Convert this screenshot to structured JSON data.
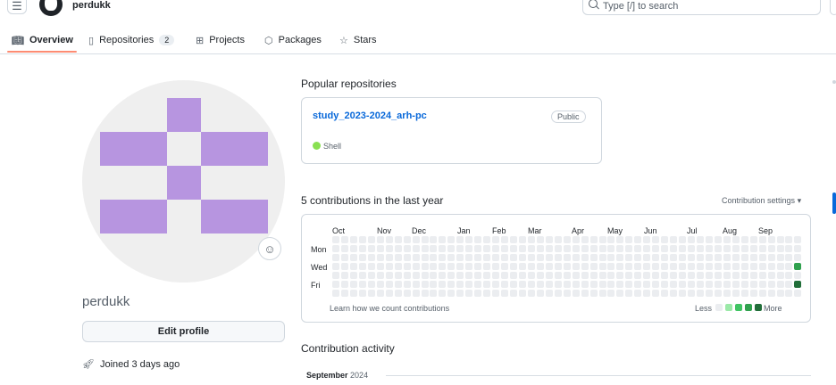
{
  "header": {
    "username": "perdukk",
    "search_placeholder": "Type [/] to search"
  },
  "tabs": [
    {
      "label": "Overview",
      "icon": "book-icon"
    },
    {
      "label": "Repositories",
      "icon": "repo-icon",
      "count": "2"
    },
    {
      "label": "Projects",
      "icon": "table-icon"
    },
    {
      "label": "Packages",
      "icon": "package-icon"
    },
    {
      "label": "Stars",
      "icon": "star-icon"
    }
  ],
  "profile": {
    "name": "perdukk",
    "edit_label": "Edit profile",
    "joined": "Joined 3 days ago",
    "avatar_color": "#b795e0"
  },
  "popular": {
    "title": "Popular repositories",
    "repos": [
      {
        "name": "study_2023-2024_arh-pc",
        "visibility": "Public",
        "language": "Shell",
        "language_color": "#89e051"
      }
    ]
  },
  "contributions": {
    "title": "5 contributions in the last year",
    "settings_label": "Contribution settings",
    "months": [
      "Oct",
      "Nov",
      "Dec",
      "Jan",
      "Feb",
      "Mar",
      "Apr",
      "May",
      "Jun",
      "Jul",
      "Aug",
      "Sep"
    ],
    "day_labels": [
      "Mon",
      "Wed",
      "Fri"
    ],
    "learn_link": "Learn how we count contributions",
    "legend_less": "Less",
    "legend_more": "More",
    "legend_colors": [
      "#ebedf0",
      "#9be9a8",
      "#40c463",
      "#30a14e",
      "#216e39"
    ],
    "active_cells": [
      {
        "week": 52,
        "day": 3,
        "level": 3
      },
      {
        "week": 52,
        "day": 5,
        "level": 4
      }
    ]
  },
  "activity": {
    "title": "Contribution activity",
    "month": "September",
    "year": "2024"
  }
}
